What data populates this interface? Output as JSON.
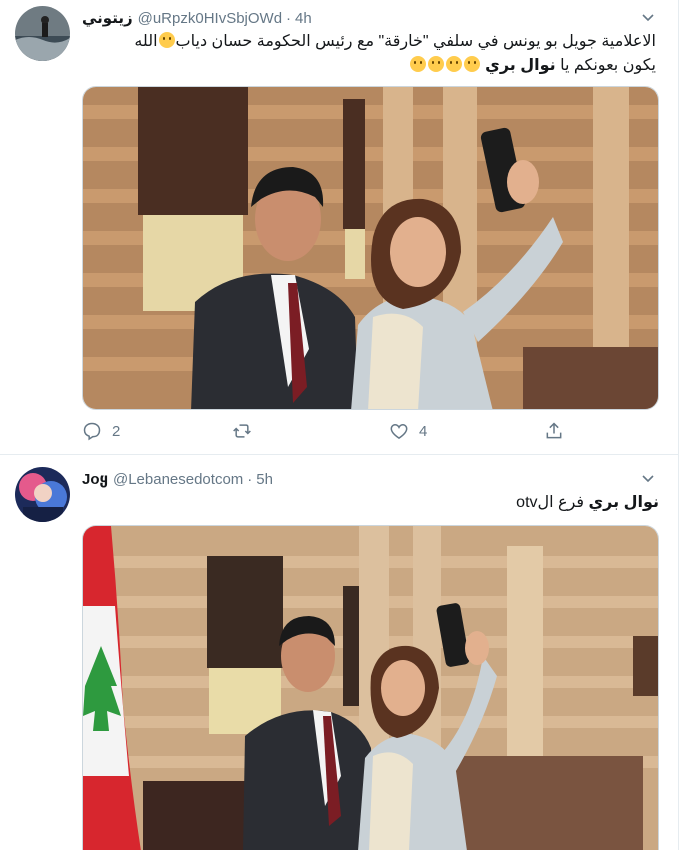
{
  "tweets": [
    {
      "display_name": "زيتوني",
      "handle": "@uRpzk0HIvSbjOWd",
      "separator": "·",
      "time": "4h",
      "text_line1": "الاعلامية جويل بو يونس في سلفي \"خارقة\" مع رئيس الحكومة حسان دياب",
      "text_line1_end": "الله",
      "text_line2_pre": "يكون بعونكم يا",
      "text_line2_bold": "نوال بري",
      "reply_count": "2",
      "retweet_count": "",
      "like_count": "4",
      "icons": {
        "reply": "reply-icon",
        "retweet": "retweet-icon",
        "like": "like-icon",
        "share": "share-icon",
        "menu": "chevron-down-icon"
      }
    },
    {
      "display_name": "Joყ",
      "handle": "@Lebanesedotcom",
      "separator": "·",
      "time": "5h",
      "text_bold": "نوال بري",
      "text_rest": "فرع الotv"
    }
  ],
  "colors": {
    "secondary_text": "#657786",
    "border": "#e6ecf0",
    "link": "#1da1f2"
  }
}
